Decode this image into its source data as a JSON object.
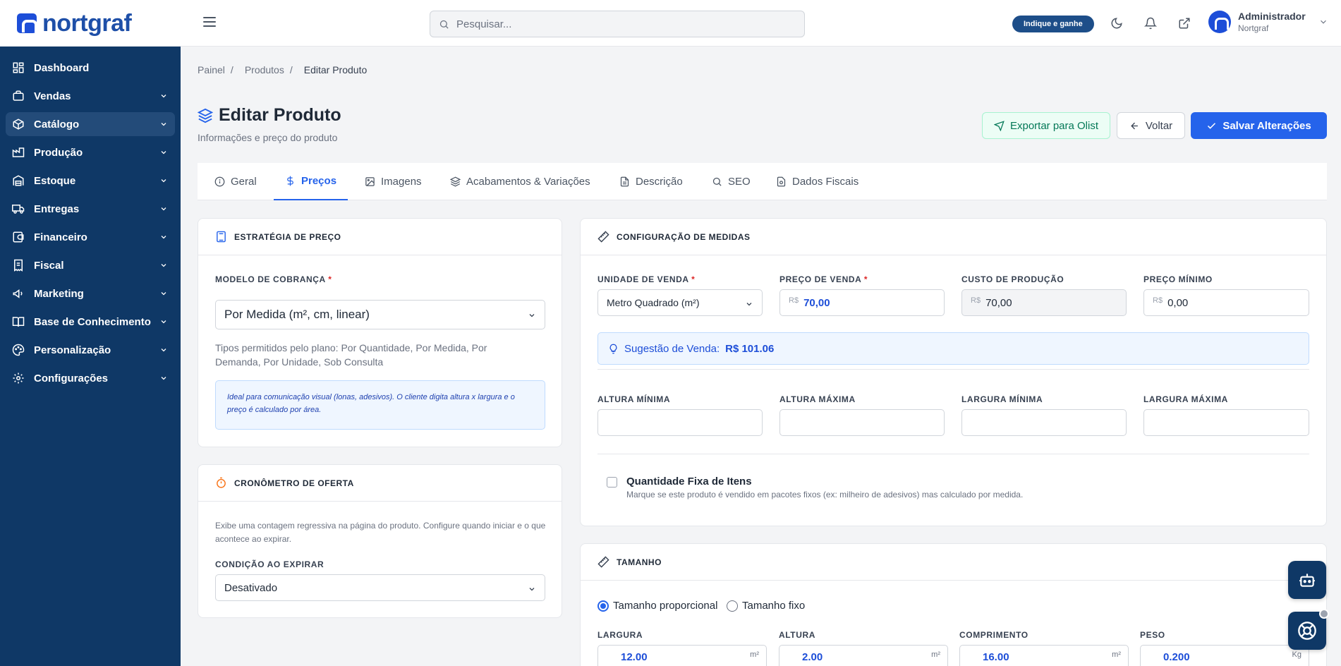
{
  "app": {
    "logo_text": "nortgraf"
  },
  "topbar": {
    "search_placeholder": "Pesquisar...",
    "promo_label": "Indique e ganhe",
    "user_name": "Administrador",
    "user_org": "Nortgraf"
  },
  "sidebar": {
    "items": [
      {
        "label": "Dashboard",
        "icon": "grid-icon"
      },
      {
        "label": "Vendas",
        "icon": "shop-icon"
      },
      {
        "label": "Catálogo",
        "icon": "box-icon"
      },
      {
        "label": "Produção",
        "icon": "factory-icon"
      },
      {
        "label": "Estoque",
        "icon": "warehouse-icon"
      },
      {
        "label": "Entregas",
        "icon": "truck-icon"
      },
      {
        "label": "Financeiro",
        "icon": "wallet-icon"
      },
      {
        "label": "Fiscal",
        "icon": "receipt-icon"
      },
      {
        "label": "Marketing",
        "icon": "megaphone-icon"
      },
      {
        "label": "Base de Conhecimento",
        "icon": "book-icon"
      },
      {
        "label": "Personalização",
        "icon": "palette-icon"
      },
      {
        "label": "Configurações",
        "icon": "gear-icon"
      }
    ],
    "active": "Catálogo"
  },
  "breadcrumb": {
    "home": "Painel",
    "section": "Produtos",
    "current": "Editar Produto"
  },
  "page": {
    "title": "Editar Produto",
    "subtitle": "Informações e preço do produto",
    "export_label": "Exportar para Olist",
    "back_label": "Voltar",
    "save_label": "Salvar Alterações"
  },
  "tabs": [
    {
      "label": "Geral"
    },
    {
      "label": "Preços"
    },
    {
      "label": "Imagens"
    },
    {
      "label": "Acabamentos & Variações"
    },
    {
      "label": "Descrição"
    },
    {
      "label": "SEO"
    },
    {
      "label": "Dados Fiscais"
    }
  ],
  "active_tab": "Preços",
  "pricing_strategy": {
    "header": "ESTRATÉGIA DE PREÇO",
    "model_label": "MODELO DE COBRANÇA",
    "required_mark": "*",
    "model_value": "Por Medida (m², cm, linear)",
    "allowed_types": "Tipos permitidos pelo plano: Por Quantidade, Por Medida, Por Demanda, Por Unidade, Sob Consulta",
    "info": "Ideal para comunicação visual (lonas, adesivos). O cliente digita altura x largura e o preço é calculado por área."
  },
  "offer_timer": {
    "header": "CRONÔMETRO DE OFERTA",
    "description": "Exibe uma contagem regressiva na página do produto. Configure quando iniciar e o que acontece ao expirar.",
    "expire_label": "CONDIÇÃO AO EXPIRAR",
    "expire_value": "Desativado"
  },
  "measures": {
    "header": "CONFIGURAÇÃO DE MEDIDAS",
    "unit_label": "UNIDADE DE VENDA",
    "unit_value": "Metro Quadrado (m²)",
    "price_label": "PREÇO DE VENDA",
    "price_value": "70,00",
    "cost_label": "CUSTO DE PRODUÇÃO",
    "cost_value": "70,00",
    "min_price_label": "PREÇO MÍNIMO",
    "min_price_value": "0,00",
    "currency": "R$",
    "suggestion_label": "Sugestão de Venda:",
    "suggestion_value": "R$ 101.06",
    "min_height_label": "ALTURA MÍNIMA",
    "max_height_label": "ALTURA MÁXIMA",
    "min_width_label": "LARGURA MÍNIMA",
    "max_width_label": "LARGURA MÁXIMA",
    "fixed_qty_title": "Quantidade Fixa de Itens",
    "fixed_qty_desc": "Marque se este produto é vendido em pacotes fixos (ex: milheiro de adesivos) mas calculado por medida."
  },
  "size": {
    "header": "TAMANHO",
    "proportional_label": "Tamanho proporcional",
    "fixed_label": "Tamanho fixo",
    "selected": "proportional",
    "width_label": "LARGURA",
    "width_value": "12.00",
    "height_label": "ALTURA",
    "height_value": "2.00",
    "length_label": "COMPRIMENTO",
    "length_value": "16.00",
    "weight_label": "PESO",
    "weight_value": "0.200",
    "area_unit": "m²",
    "weight_unit": "Kg"
  },
  "colors": {
    "sidebar": "#0f3866",
    "accent": "#2563eb",
    "success": "#047857"
  }
}
